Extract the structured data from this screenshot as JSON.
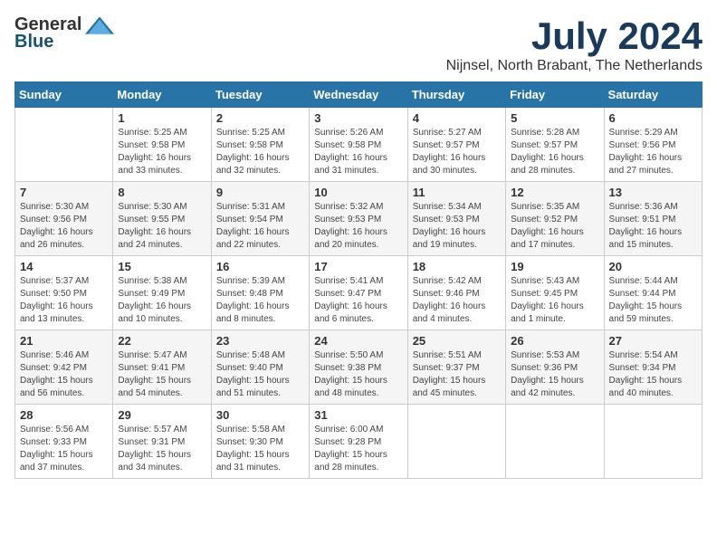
{
  "header": {
    "logo_general": "General",
    "logo_blue": "Blue",
    "month_title": "July 2024",
    "location": "Nijnsel, North Brabant, The Netherlands"
  },
  "calendar": {
    "days_of_week": [
      "Sunday",
      "Monday",
      "Tuesday",
      "Wednesday",
      "Thursday",
      "Friday",
      "Saturday"
    ],
    "weeks": [
      [
        {
          "day": "",
          "info": ""
        },
        {
          "day": "1",
          "info": "Sunrise: 5:25 AM\nSunset: 9:58 PM\nDaylight: 16 hours\nand 33 minutes."
        },
        {
          "day": "2",
          "info": "Sunrise: 5:25 AM\nSunset: 9:58 PM\nDaylight: 16 hours\nand 32 minutes."
        },
        {
          "day": "3",
          "info": "Sunrise: 5:26 AM\nSunset: 9:58 PM\nDaylight: 16 hours\nand 31 minutes."
        },
        {
          "day": "4",
          "info": "Sunrise: 5:27 AM\nSunset: 9:57 PM\nDaylight: 16 hours\nand 30 minutes."
        },
        {
          "day": "5",
          "info": "Sunrise: 5:28 AM\nSunset: 9:57 PM\nDaylight: 16 hours\nand 28 minutes."
        },
        {
          "day": "6",
          "info": "Sunrise: 5:29 AM\nSunset: 9:56 PM\nDaylight: 16 hours\nand 27 minutes."
        }
      ],
      [
        {
          "day": "7",
          "info": "Sunrise: 5:30 AM\nSunset: 9:56 PM\nDaylight: 16 hours\nand 26 minutes."
        },
        {
          "day": "8",
          "info": "Sunrise: 5:30 AM\nSunset: 9:55 PM\nDaylight: 16 hours\nand 24 minutes."
        },
        {
          "day": "9",
          "info": "Sunrise: 5:31 AM\nSunset: 9:54 PM\nDaylight: 16 hours\nand 22 minutes."
        },
        {
          "day": "10",
          "info": "Sunrise: 5:32 AM\nSunset: 9:53 PM\nDaylight: 16 hours\nand 20 minutes."
        },
        {
          "day": "11",
          "info": "Sunrise: 5:34 AM\nSunset: 9:53 PM\nDaylight: 16 hours\nand 19 minutes."
        },
        {
          "day": "12",
          "info": "Sunrise: 5:35 AM\nSunset: 9:52 PM\nDaylight: 16 hours\nand 17 minutes."
        },
        {
          "day": "13",
          "info": "Sunrise: 5:36 AM\nSunset: 9:51 PM\nDaylight: 16 hours\nand 15 minutes."
        }
      ],
      [
        {
          "day": "14",
          "info": "Sunrise: 5:37 AM\nSunset: 9:50 PM\nDaylight: 16 hours\nand 13 minutes."
        },
        {
          "day": "15",
          "info": "Sunrise: 5:38 AM\nSunset: 9:49 PM\nDaylight: 16 hours\nand 10 minutes."
        },
        {
          "day": "16",
          "info": "Sunrise: 5:39 AM\nSunset: 9:48 PM\nDaylight: 16 hours\nand 8 minutes."
        },
        {
          "day": "17",
          "info": "Sunrise: 5:41 AM\nSunset: 9:47 PM\nDaylight: 16 hours\nand 6 minutes."
        },
        {
          "day": "18",
          "info": "Sunrise: 5:42 AM\nSunset: 9:46 PM\nDaylight: 16 hours\nand 4 minutes."
        },
        {
          "day": "19",
          "info": "Sunrise: 5:43 AM\nSunset: 9:45 PM\nDaylight: 16 hours\nand 1 minute."
        },
        {
          "day": "20",
          "info": "Sunrise: 5:44 AM\nSunset: 9:44 PM\nDaylight: 15 hours\nand 59 minutes."
        }
      ],
      [
        {
          "day": "21",
          "info": "Sunrise: 5:46 AM\nSunset: 9:42 PM\nDaylight: 15 hours\nand 56 minutes."
        },
        {
          "day": "22",
          "info": "Sunrise: 5:47 AM\nSunset: 9:41 PM\nDaylight: 15 hours\nand 54 minutes."
        },
        {
          "day": "23",
          "info": "Sunrise: 5:48 AM\nSunset: 9:40 PM\nDaylight: 15 hours\nand 51 minutes."
        },
        {
          "day": "24",
          "info": "Sunrise: 5:50 AM\nSunset: 9:38 PM\nDaylight: 15 hours\nand 48 minutes."
        },
        {
          "day": "25",
          "info": "Sunrise: 5:51 AM\nSunset: 9:37 PM\nDaylight: 15 hours\nand 45 minutes."
        },
        {
          "day": "26",
          "info": "Sunrise: 5:53 AM\nSunset: 9:36 PM\nDaylight: 15 hours\nand 42 minutes."
        },
        {
          "day": "27",
          "info": "Sunrise: 5:54 AM\nSunset: 9:34 PM\nDaylight: 15 hours\nand 40 minutes."
        }
      ],
      [
        {
          "day": "28",
          "info": "Sunrise: 5:56 AM\nSunset: 9:33 PM\nDaylight: 15 hours\nand 37 minutes."
        },
        {
          "day": "29",
          "info": "Sunrise: 5:57 AM\nSunset: 9:31 PM\nDaylight: 15 hours\nand 34 minutes."
        },
        {
          "day": "30",
          "info": "Sunrise: 5:58 AM\nSunset: 9:30 PM\nDaylight: 15 hours\nand 31 minutes."
        },
        {
          "day": "31",
          "info": "Sunrise: 6:00 AM\nSunset: 9:28 PM\nDaylight: 15 hours\nand 28 minutes."
        },
        {
          "day": "",
          "info": ""
        },
        {
          "day": "",
          "info": ""
        },
        {
          "day": "",
          "info": ""
        }
      ]
    ]
  }
}
